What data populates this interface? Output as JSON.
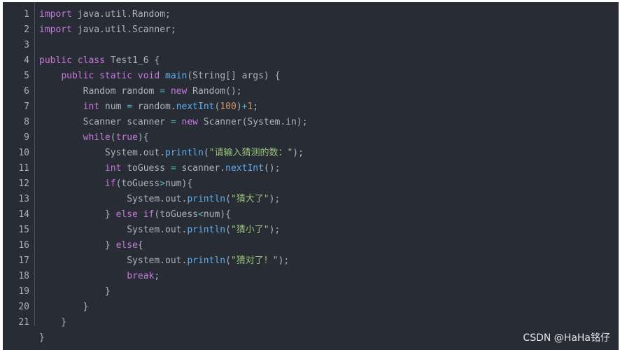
{
  "line_numbers": [
    "1",
    "2",
    "3",
    "4",
    "5",
    "6",
    "7",
    "8",
    "9",
    "10",
    "11",
    "12",
    "13",
    "14",
    "15",
    "16",
    "17",
    "18",
    "19",
    "20",
    "21"
  ],
  "code_lines": [
    [
      {
        "t": "import",
        "c": "kw"
      },
      {
        "t": " java.util.Random;",
        "c": ""
      }
    ],
    [
      {
        "t": "import",
        "c": "kw"
      },
      {
        "t": " java.util.Scanner;",
        "c": ""
      }
    ],
    [],
    [
      {
        "t": "public",
        "c": "kw"
      },
      {
        "t": " ",
        "c": ""
      },
      {
        "t": "class",
        "c": "kw"
      },
      {
        "t": " Test1_6 {",
        "c": ""
      }
    ],
    [
      {
        "t": "    ",
        "c": ""
      },
      {
        "t": "public",
        "c": "kw"
      },
      {
        "t": " ",
        "c": ""
      },
      {
        "t": "static",
        "c": "kw"
      },
      {
        "t": " ",
        "c": ""
      },
      {
        "t": "void",
        "c": "kw"
      },
      {
        "t": " ",
        "c": ""
      },
      {
        "t": "main",
        "c": "fn"
      },
      {
        "t": "(String[] args) {",
        "c": ""
      }
    ],
    [
      {
        "t": "        Random random ",
        "c": ""
      },
      {
        "t": "=",
        "c": "op"
      },
      {
        "t": " ",
        "c": ""
      },
      {
        "t": "new",
        "c": "kw"
      },
      {
        "t": " Random();",
        "c": ""
      }
    ],
    [
      {
        "t": "        ",
        "c": ""
      },
      {
        "t": "int",
        "c": "kw"
      },
      {
        "t": " num ",
        "c": ""
      },
      {
        "t": "=",
        "c": "op"
      },
      {
        "t": " random.",
        "c": ""
      },
      {
        "t": "nextInt",
        "c": "fn"
      },
      {
        "t": "(",
        "c": ""
      },
      {
        "t": "100",
        "c": "num"
      },
      {
        "t": ")",
        "c": ""
      },
      {
        "t": "+",
        "c": "op"
      },
      {
        "t": "1",
        "c": "num"
      },
      {
        "t": ";",
        "c": ""
      }
    ],
    [
      {
        "t": "        Scanner scanner ",
        "c": ""
      },
      {
        "t": "=",
        "c": "op"
      },
      {
        "t": " ",
        "c": ""
      },
      {
        "t": "new",
        "c": "kw"
      },
      {
        "t": " Scanner(System.in);",
        "c": ""
      }
    ],
    [
      {
        "t": "        ",
        "c": ""
      },
      {
        "t": "while",
        "c": "kw"
      },
      {
        "t": "(",
        "c": ""
      },
      {
        "t": "true",
        "c": "kw"
      },
      {
        "t": "){",
        "c": ""
      }
    ],
    [
      {
        "t": "            System.out.",
        "c": ""
      },
      {
        "t": "println",
        "c": "fn"
      },
      {
        "t": "(",
        "c": ""
      },
      {
        "t": "\"请输入猜测的数：\"",
        "c": "str"
      },
      {
        "t": ");",
        "c": ""
      }
    ],
    [
      {
        "t": "            ",
        "c": ""
      },
      {
        "t": "int",
        "c": "kw"
      },
      {
        "t": " toGuess ",
        "c": ""
      },
      {
        "t": "=",
        "c": "op"
      },
      {
        "t": " scanner.",
        "c": ""
      },
      {
        "t": "nextInt",
        "c": "fn"
      },
      {
        "t": "();",
        "c": ""
      }
    ],
    [
      {
        "t": "            ",
        "c": ""
      },
      {
        "t": "if",
        "c": "kw"
      },
      {
        "t": "(toGuess",
        "c": ""
      },
      {
        "t": ">",
        "c": "op"
      },
      {
        "t": "num){",
        "c": ""
      }
    ],
    [
      {
        "t": "                System.out.",
        "c": ""
      },
      {
        "t": "println",
        "c": "fn"
      },
      {
        "t": "(",
        "c": ""
      },
      {
        "t": "\"猜大了\"",
        "c": "str"
      },
      {
        "t": ");",
        "c": ""
      }
    ],
    [
      {
        "t": "            } ",
        "c": ""
      },
      {
        "t": "else",
        "c": "kw"
      },
      {
        "t": " ",
        "c": ""
      },
      {
        "t": "if",
        "c": "kw"
      },
      {
        "t": "(toGuess",
        "c": ""
      },
      {
        "t": "<",
        "c": "op"
      },
      {
        "t": "num){",
        "c": ""
      }
    ],
    [
      {
        "t": "                System.out.",
        "c": ""
      },
      {
        "t": "println",
        "c": "fn"
      },
      {
        "t": "(",
        "c": ""
      },
      {
        "t": "\"猜小了\"",
        "c": "str"
      },
      {
        "t": ");",
        "c": ""
      }
    ],
    [
      {
        "t": "            } ",
        "c": ""
      },
      {
        "t": "else",
        "c": "kw"
      },
      {
        "t": "{",
        "c": ""
      }
    ],
    [
      {
        "t": "                System.out.",
        "c": ""
      },
      {
        "t": "println",
        "c": "fn"
      },
      {
        "t": "(",
        "c": ""
      },
      {
        "t": "\"猜对了！\"",
        "c": "str"
      },
      {
        "t": ");",
        "c": ""
      }
    ],
    [
      {
        "t": "                ",
        "c": ""
      },
      {
        "t": "break",
        "c": "kw"
      },
      {
        "t": ";",
        "c": ""
      }
    ],
    [
      {
        "t": "            }",
        "c": ""
      }
    ],
    [
      {
        "t": "        }",
        "c": ""
      }
    ],
    [
      {
        "t": "    }",
        "c": ""
      }
    ],
    [
      {
        "t": "}",
        "c": ""
      }
    ]
  ],
  "watermark": "CSDN @HaHa铭仔",
  "colors": {
    "background": "#282c34",
    "keyword": "#c678dd",
    "function": "#61aeee",
    "number": "#d19a66",
    "string": "#98c379",
    "operator": "#56b6c2",
    "text": "#abb2bf"
  }
}
